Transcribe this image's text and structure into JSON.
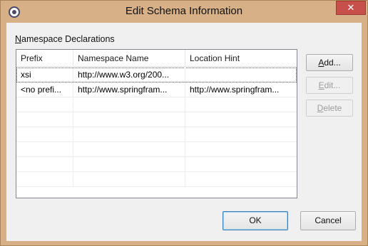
{
  "window": {
    "title": "Edit Schema Information",
    "close_glyph": "✕"
  },
  "group": {
    "label_mnemonic": "N",
    "label_rest": "amespace Declarations"
  },
  "table": {
    "columns": [
      "Prefix",
      "Namespace Name",
      "Location Hint"
    ],
    "rows": [
      {
        "prefix": "xsi",
        "namespace": "http://www.w3.org/200...",
        "location": ""
      },
      {
        "prefix": "<no prefi...",
        "namespace": "http://www.springfram...",
        "location": "http://www.springfram..."
      },
      {
        "prefix": "",
        "namespace": "",
        "location": ""
      },
      {
        "prefix": "",
        "namespace": "",
        "location": ""
      },
      {
        "prefix": "",
        "namespace": "",
        "location": ""
      },
      {
        "prefix": "",
        "namespace": "",
        "location": ""
      },
      {
        "prefix": "",
        "namespace": "",
        "location": ""
      },
      {
        "prefix": "",
        "namespace": "",
        "location": ""
      }
    ]
  },
  "buttons": {
    "add_mn": "A",
    "add_rest": "dd...",
    "edit_mn": "E",
    "edit_rest": "dit...",
    "delete_mn": "D",
    "delete_rest": "elete",
    "ok": "OK",
    "cancel": "Cancel"
  },
  "icons": {
    "app": "eclipse-app-icon",
    "close": "close-icon"
  },
  "colors": {
    "titlebar": "#d7b088",
    "close": "#c7504a",
    "client": "#f0f0f0"
  }
}
